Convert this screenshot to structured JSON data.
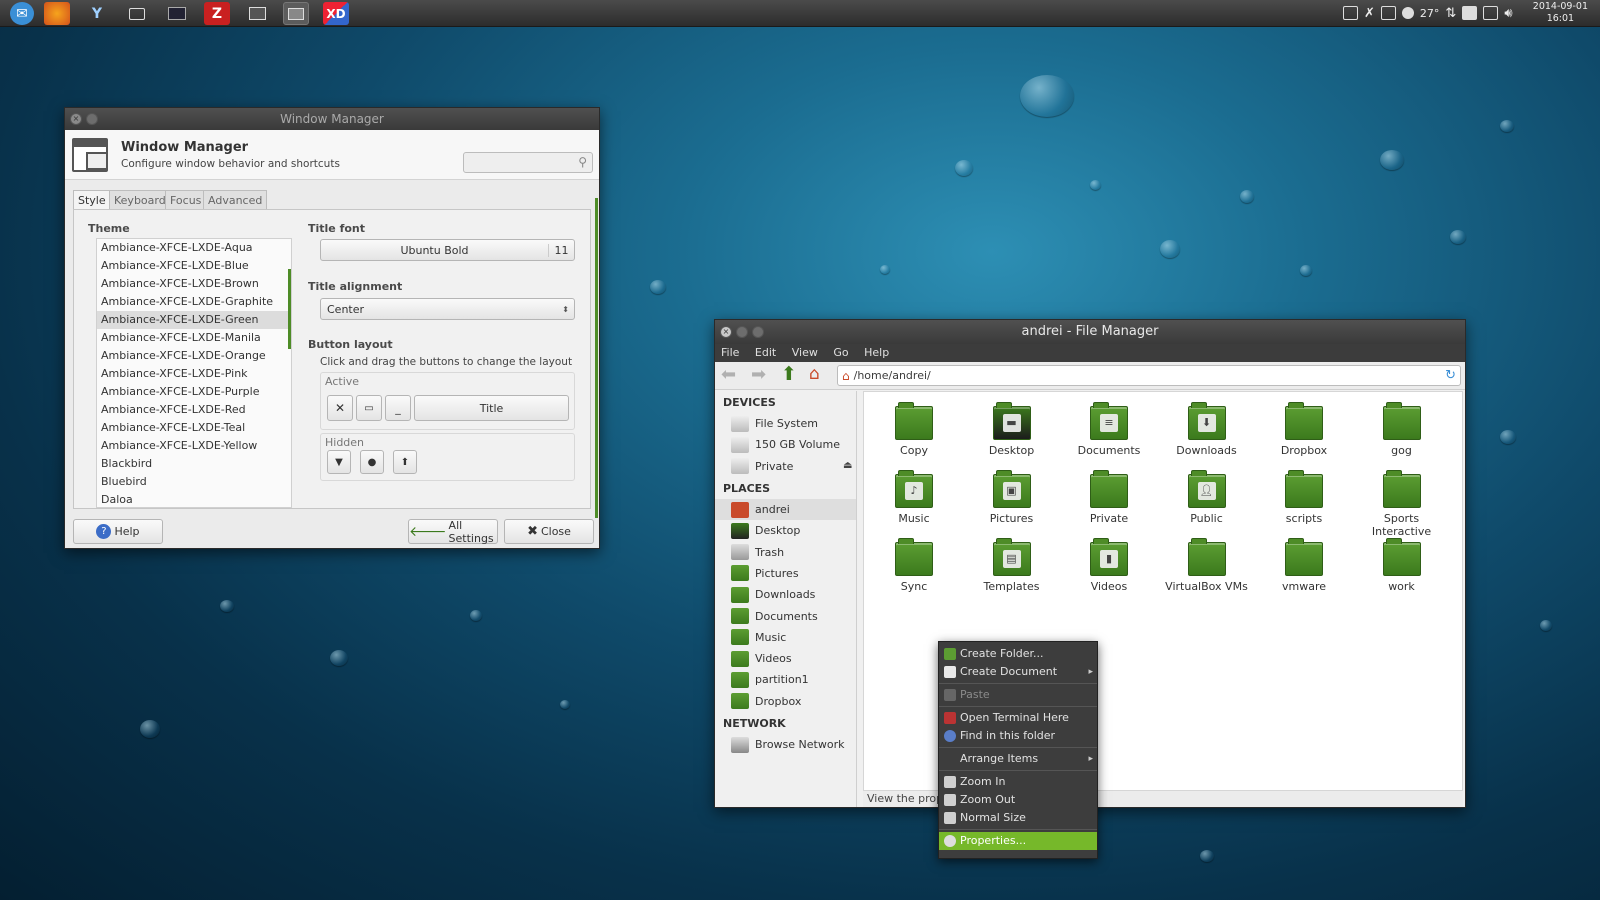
{
  "taskbar": {
    "launchers": [
      "thunderbird-icon",
      "firefox-icon",
      "yakuake-icon",
      "files-icon",
      "system-monitor-icon",
      "filezilla-icon",
      "window-manager-icon",
      "file-manager-icon",
      "xd-icon"
    ],
    "temperature": "27°",
    "clock_date": "2014-09-01",
    "clock_time": "16:01"
  },
  "wm": {
    "window_title": "Window Manager",
    "header_title": "Window Manager",
    "header_subtitle": "Configure window behavior and shortcuts",
    "tabs": [
      "Style",
      "Keyboard",
      "Focus",
      "Advanced"
    ],
    "theme_label": "Theme",
    "themes": [
      "Ambiance-XFCE-LXDE-Aqua",
      "Ambiance-XFCE-LXDE-Blue",
      "Ambiance-XFCE-LXDE-Brown",
      "Ambiance-XFCE-LXDE-Graphite",
      "Ambiance-XFCE-LXDE-Green",
      "Ambiance-XFCE-LXDE-Manila",
      "Ambiance-XFCE-LXDE-Orange",
      "Ambiance-XFCE-LXDE-Pink",
      "Ambiance-XFCE-LXDE-Purple",
      "Ambiance-XFCE-LXDE-Red",
      "Ambiance-XFCE-LXDE-Teal",
      "Ambiance-XFCE-LXDE-Yellow",
      "Blackbird",
      "Bluebird",
      "Daloa"
    ],
    "selected_theme": "Ambiance-XFCE-LXDE-Green",
    "title_font_label": "Title font",
    "title_font": "Ubuntu Bold",
    "title_font_size": "11",
    "title_alignment_label": "Title alignment",
    "title_alignment": "Center",
    "button_layout_label": "Button layout",
    "button_layout_hint": "Click and drag the buttons to change the layout",
    "active_label": "Active",
    "active_title": "Title",
    "hidden_label": "Hidden",
    "help_label": "Help",
    "all_settings_label": "All Settings",
    "close_label": "Close"
  },
  "fm": {
    "window_title": "andrei - File Manager",
    "menu": [
      "File",
      "Edit",
      "View",
      "Go",
      "Help"
    ],
    "path": "/home/andrei/",
    "devices_label": "DEVICES",
    "devices": [
      "File System",
      "150 GB Volume",
      "Private"
    ],
    "places_label": "PLACES",
    "places": [
      "andrei",
      "Desktop",
      "Trash",
      "Pictures",
      "Downloads",
      "Documents",
      "Music",
      "Videos",
      "partition1",
      "Dropbox"
    ],
    "network_label": "NETWORK",
    "network": [
      "Browse Network"
    ],
    "folders": [
      "Copy",
      "Desktop",
      "Documents",
      "Downloads",
      "Dropbox",
      "gog",
      "Music",
      "Pictures",
      "Private",
      "Public",
      "scripts",
      "Sports Interactive",
      "Sync",
      "Templates",
      "Videos",
      "VirtualBox VMs",
      "vmware",
      "work"
    ],
    "status": "View the prope"
  },
  "context_menu": {
    "items": [
      "Create Folder...",
      "Create Document",
      "Paste",
      "Open Terminal Here",
      "Find in this folder",
      "Arrange Items",
      "Zoom In",
      "Zoom Out",
      "Normal Size",
      "Properties..."
    ]
  },
  "colors": {
    "accent": "#76b82a",
    "folder": "#4e8c27"
  }
}
